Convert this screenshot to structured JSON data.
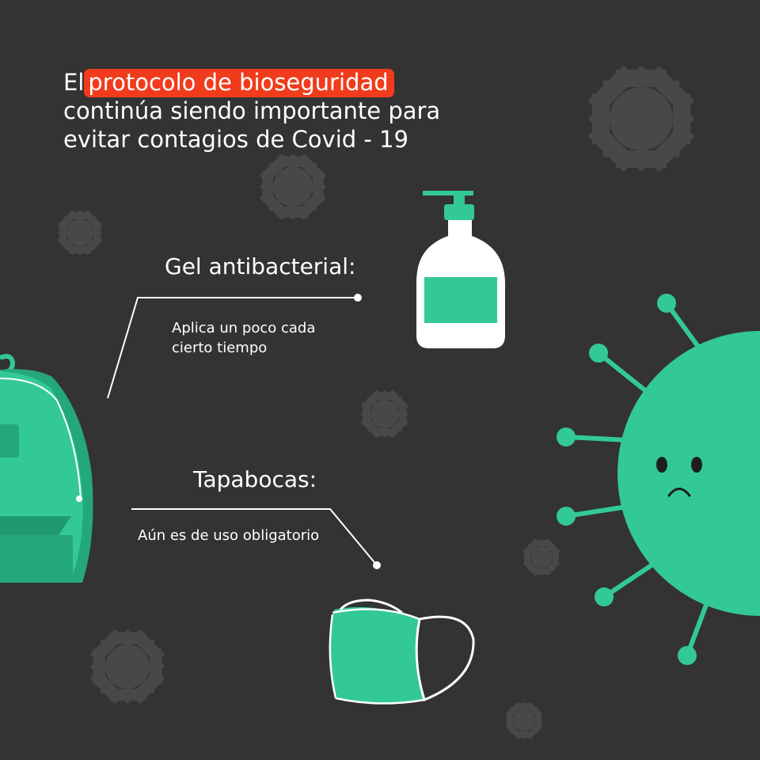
{
  "headline": {
    "prefix": "El",
    "highlight": "protocolo de bioseguridad",
    "line2": "continúa siendo importante para",
    "line3": "evitar contagios de Covid - 19"
  },
  "items": [
    {
      "title": "Gel antibacterial:",
      "desc_line1": "Aplica un poco cada",
      "desc_line2": "cierto tiempo"
    },
    {
      "title": "Tapabocas:",
      "desc": "Aún es de uso obligatorio"
    }
  ],
  "colors": {
    "background": "#333333",
    "highlight": "#f03c1c",
    "green": "#33c994",
    "dark_green": "#24a87a",
    "white": "#ffffff",
    "virus_grey": "#484848"
  },
  "icons": [
    "virus-icon",
    "soap-bottle-icon",
    "face-mask-icon",
    "backpack-icon",
    "sad-virus-icon"
  ]
}
